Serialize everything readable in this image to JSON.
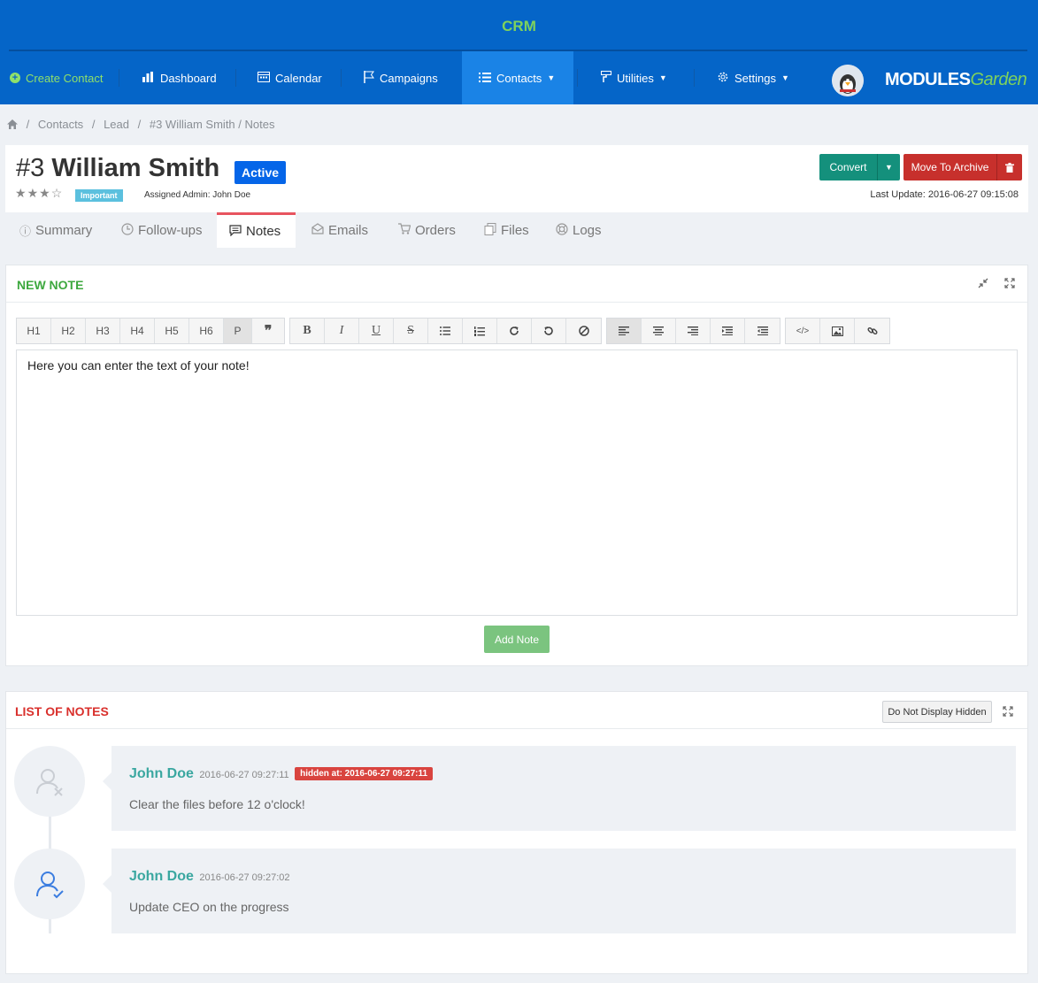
{
  "app": {
    "title": "CRM"
  },
  "nav": {
    "create": "Create Contact",
    "dashboard": "Dashboard",
    "calendar": "Calendar",
    "campaigns": "Campaigns",
    "contacts": "Contacts",
    "utilities": "Utilities",
    "settings": "Settings",
    "logo_main": "MODULES",
    "logo_sub": "Garden"
  },
  "breadcrumb": [
    "Contacts",
    "Lead",
    "#3 William Smith / Notes"
  ],
  "contact": {
    "id": "#3",
    "name": "William Smith",
    "status": "Active",
    "status_color": "#0565e8",
    "rating": 3,
    "rating_max": 5,
    "priority": "Important",
    "assigned": "Assigned Admin: John Doe",
    "last_update": "Last Update: 2016-06-27 09:15:08"
  },
  "actions": {
    "convert": "Convert",
    "archive": "Move To Archive"
  },
  "tabs": [
    "Summary",
    "Follow-ups",
    "Notes",
    "Emails",
    "Orders",
    "Files",
    "Logs"
  ],
  "active_tab": "Notes",
  "new_note": {
    "title": "NEW NOTE",
    "title_color": "#3da83e",
    "toolbar_headings": [
      "H1",
      "H2",
      "H3",
      "H4",
      "H5",
      "H6",
      "P"
    ],
    "editor_text": "Here you can enter the text of your note!",
    "submit": "Add Note"
  },
  "list": {
    "title": "LIST OF NOTES",
    "title_color": "#d9302c",
    "filter_button": "Do Not Display Hidden",
    "notes": [
      {
        "author": "John Doe",
        "time": "2016-06-27 09:27:11",
        "hidden": "hidden at: 2016-06-27 09:27:11",
        "text": "Clear the files before 12 o'clock!"
      },
      {
        "author": "John Doe",
        "time": "2016-06-27 09:27:02",
        "text": "Update CEO on the progress"
      }
    ]
  }
}
